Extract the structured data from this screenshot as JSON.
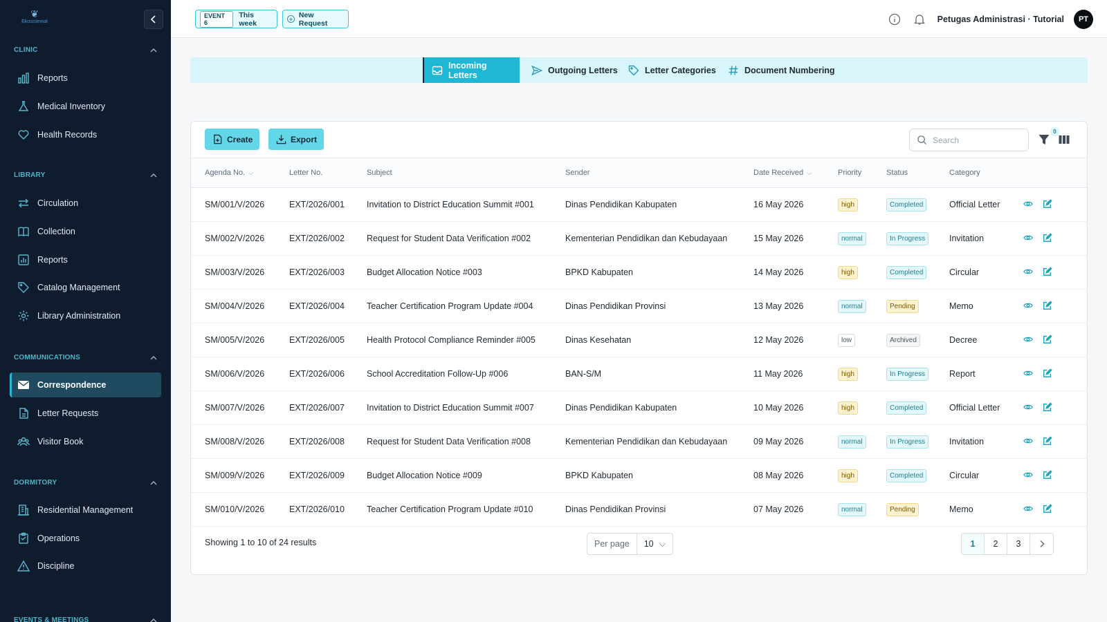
{
  "logo_text": "Ekosistemal",
  "sidebar": {
    "sections": [
      {
        "title": "CLINIC",
        "items": [
          {
            "label": "Reports",
            "icon": "bar-chart-icon"
          },
          {
            "label": "Medical Inventory",
            "icon": "flask-icon"
          },
          {
            "label": "Health Records",
            "icon": "heart-icon"
          }
        ]
      },
      {
        "title": "LIBRARY",
        "items": [
          {
            "label": "Circulation",
            "icon": "arrows-exchange-icon"
          },
          {
            "label": "Collection",
            "icon": "book-icon"
          },
          {
            "label": "Reports",
            "icon": "chart-box-icon"
          },
          {
            "label": "Catalog Management",
            "icon": "tag-icon"
          },
          {
            "label": "Library Administration",
            "icon": "gear-icon"
          }
        ]
      },
      {
        "title": "COMMUNICATIONS",
        "items": [
          {
            "label": "Correspondence",
            "icon": "mail-icon",
            "active": true
          },
          {
            "label": "Letter Requests",
            "icon": "document-icon"
          },
          {
            "label": "Visitor Book",
            "icon": "users-icon"
          }
        ]
      },
      {
        "title": "DORMITORY",
        "items": [
          {
            "label": "Residential Management",
            "icon": "building-icon"
          },
          {
            "label": "Operations",
            "icon": "clipboard-icon"
          },
          {
            "label": "Discipline",
            "icon": "warning-icon"
          }
        ]
      },
      {
        "title": "EVENTS & MEETINGS",
        "items": []
      }
    ]
  },
  "topbar": {
    "event_badge": "EVENT 6",
    "event_label": "This week",
    "new_request": "New Request",
    "user_name": "Petugas Administrasi · Tutorial",
    "avatar_initials": "PT"
  },
  "tabs": [
    {
      "label": "Incoming Letters",
      "icon": "inbox-icon",
      "active": true
    },
    {
      "label": "Outgoing Letters",
      "icon": "send-icon"
    },
    {
      "label": "Letter Categories",
      "icon": "tag-icon"
    },
    {
      "label": "Document Numbering",
      "icon": "hash-icon"
    }
  ],
  "toolbar": {
    "create_label": "Create",
    "export_label": "Export",
    "search_placeholder": "Search",
    "filter_count": "0"
  },
  "table": {
    "headers": [
      "Agenda No.",
      "Letter No.",
      "Subject",
      "Sender",
      "Date Received",
      "Priority",
      "Status",
      "Category"
    ],
    "rows": [
      [
        "SM/001/V/2026",
        "EXT/2026/001",
        "Invitation to District Education Summit #001",
        "Dinas Pendidikan Kabupaten",
        "16 May 2026",
        "high",
        "Completed",
        "Official Letter"
      ],
      [
        "SM/002/V/2026",
        "EXT/2026/002",
        "Request for Student Data Verification #002",
        "Kementerian Pendidikan dan Kebudayaan",
        "15 May 2026",
        "normal",
        "In Progress",
        "Invitation"
      ],
      [
        "SM/003/V/2026",
        "EXT/2026/003",
        "Budget Allocation Notice #003",
        "BPKD Kabupaten",
        "14 May 2026",
        "high",
        "Completed",
        "Circular"
      ],
      [
        "SM/004/V/2026",
        "EXT/2026/004",
        "Teacher Certification Program Update #004",
        "Dinas Pendidikan Provinsi",
        "13 May 2026",
        "normal",
        "Pending",
        "Memo"
      ],
      [
        "SM/005/V/2026",
        "EXT/2026/005",
        "Health Protocol Compliance Reminder #005",
        "Dinas Kesehatan",
        "12 May 2026",
        "low",
        "Archived",
        "Decree"
      ],
      [
        "SM/006/V/2026",
        "EXT/2026/006",
        "School Accreditation Follow-Up #006",
        "BAN-S/M",
        "11 May 2026",
        "high",
        "In Progress",
        "Report"
      ],
      [
        "SM/007/V/2026",
        "EXT/2026/007",
        "Invitation to District Education Summit #007",
        "Dinas Pendidikan Kabupaten",
        "10 May 2026",
        "high",
        "Completed",
        "Official Letter"
      ],
      [
        "SM/008/V/2026",
        "EXT/2026/008",
        "Request for Student Data Verification #008",
        "Kementerian Pendidikan dan Kebudayaan",
        "09 May 2026",
        "normal",
        "In Progress",
        "Invitation"
      ],
      [
        "SM/009/V/2026",
        "EXT/2026/009",
        "Budget Allocation Notice #009",
        "BPKD Kabupaten",
        "08 May 2026",
        "high",
        "Completed",
        "Circular"
      ],
      [
        "SM/010/V/2026",
        "EXT/2026/010",
        "Teacher Certification Program Update #010",
        "Dinas Pendidikan Provinsi",
        "07 May 2026",
        "normal",
        "Pending",
        "Memo"
      ]
    ]
  },
  "footer": {
    "showing": "Showing 1 to 10 of 24 results",
    "per_page_label": "Per page",
    "per_page_value": "10",
    "pages": [
      "1",
      "2",
      "3"
    ],
    "current_page": "1"
  },
  "colors": {
    "sidebar_bg": "#0f1c2e",
    "accent": "#1fb8d4",
    "section_heading": "#4fb4c8"
  }
}
